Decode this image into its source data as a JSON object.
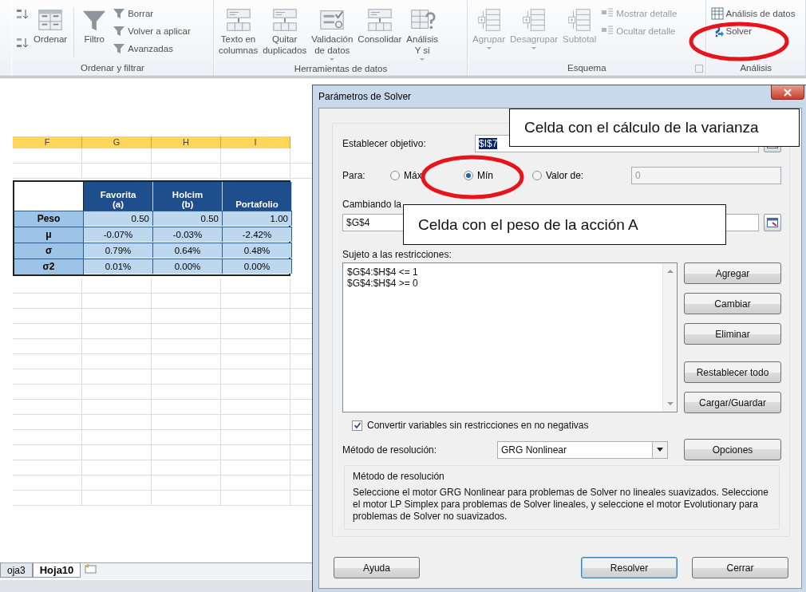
{
  "ribbon": {
    "groups": [
      {
        "label": "Ordenar y filtrar",
        "columns": [
          {
            "kind": "sort-icons"
          },
          {
            "kind": "large",
            "lines": [
              "Ordenar"
            ],
            "disabled": false,
            "dropdown": false
          },
          {
            "kind": "separator"
          },
          {
            "kind": "large",
            "lines": [
              "Filtro"
            ],
            "disabled": false,
            "dropdown": false
          },
          {
            "kind": "stack",
            "items": [
              {
                "label": "Borrar",
                "disabled": false
              },
              {
                "label": "Volver a aplicar",
                "disabled": false
              },
              {
                "label": "Avanzadas",
                "disabled": false
              }
            ]
          }
        ]
      },
      {
        "label": "Herramientas de datos",
        "columns": [
          {
            "kind": "large",
            "lines": [
              "Texto en",
              "columnas"
            ],
            "disabled": false,
            "dropdown": false
          },
          {
            "kind": "large",
            "lines": [
              "Quitar",
              "duplicados"
            ],
            "disabled": false,
            "dropdown": false
          },
          {
            "kind": "large",
            "lines": [
              "Validación",
              "de datos"
            ],
            "disabled": false,
            "dropdown": true
          },
          {
            "kind": "large",
            "lines": [
              "Consolidar"
            ],
            "disabled": false,
            "dropdown": false
          },
          {
            "kind": "large",
            "lines": [
              "Análisis",
              "Y si"
            ],
            "disabled": false,
            "dropdown": true
          }
        ]
      },
      {
        "label": "Esquema",
        "launcher": true,
        "columns": [
          {
            "kind": "large",
            "lines": [
              "Agrupar"
            ],
            "disabled": true,
            "dropdown": true
          },
          {
            "kind": "large",
            "lines": [
              "Desagrupar"
            ],
            "disabled": true,
            "dropdown": true
          },
          {
            "kind": "large",
            "lines": [
              "Subtotal"
            ],
            "disabled": true,
            "dropdown": false
          },
          {
            "kind": "stack",
            "items": [
              {
                "label": "Mostrar detalle",
                "disabled": true
              },
              {
                "label": "Ocultar detalle",
                "disabled": true
              }
            ]
          }
        ]
      },
      {
        "label": "Análisis",
        "columns": [
          {
            "kind": "stack",
            "items": [
              {
                "label": "Análisis de datos",
                "disabled": false
              },
              {
                "label": "Solver",
                "disabled": false
              }
            ]
          }
        ]
      }
    ]
  },
  "sheet": {
    "columns": [
      {
        "label": "F",
        "selected": true
      },
      {
        "label": "G",
        "selected": true
      },
      {
        "label": "H",
        "selected": true
      },
      {
        "label": "I",
        "selected": true
      }
    ],
    "table": {
      "headers": [
        {
          "lines": [
            "Favorita",
            "(a)"
          ]
        },
        {
          "lines": [
            "Holcim",
            "(b)"
          ]
        },
        {
          "lines": [
            "Portafolio"
          ]
        }
      ],
      "rows": [
        {
          "label": "Peso",
          "kind": "weight",
          "values": [
            "0.50",
            "0.50",
            "1.00"
          ]
        },
        {
          "label": "μ",
          "kind": "percent",
          "values": [
            "-0.07%",
            "-0.03%",
            "-2.42%"
          ]
        },
        {
          "label": "σ",
          "kind": "percent",
          "values": [
            "0.79%",
            "0.64%",
            "0.48%"
          ]
        },
        {
          "label": "σ2",
          "kind": "percent",
          "values": [
            "0.01%",
            "0.00%",
            "0.00%"
          ]
        }
      ]
    },
    "tabs": [
      {
        "label": "oja3",
        "selected": false
      },
      {
        "label": "Hoja10",
        "selected": true
      }
    ]
  },
  "dialog": {
    "title": "Parámetros de Solver",
    "objective": {
      "label": "Establecer objetivo:",
      "value": "$I$7",
      "value_selected": true
    },
    "para": {
      "label": "Para:",
      "options": [
        {
          "label": "Máx",
          "selected": false
        },
        {
          "label": "Mín",
          "selected": true
        },
        {
          "label": "Valor de:",
          "selected": false
        }
      ],
      "value": "0",
      "value_disabled": true
    },
    "changing": {
      "label": "Cambiando la",
      "value": "$G$4"
    },
    "constraints": {
      "label": "Sujeto a las restricciones:",
      "items": [
        "$G$4:$H$4 <= 1",
        "$G$4:$H$4 >= 0"
      ]
    },
    "side_button_groups": [
      [
        {
          "label": "Agregar"
        },
        {
          "label": "Cambiar"
        },
        {
          "label": "Eliminar"
        }
      ],
      [
        {
          "label": "Restablecer todo"
        },
        {
          "label": "Cargar/Guardar"
        }
      ]
    ],
    "nonnegative": {
      "label": "Convertir variables sin restricciones en no negativas",
      "checked": true
    },
    "method": {
      "label": "Método de resolución:",
      "value": "GRG Nonlinear",
      "button": "Opciones"
    },
    "info": {
      "title": "Método de resolución",
      "text": "Seleccione el motor GRG Nonlinear para problemas de Solver no lineales suavizados. Seleccione el motor LP Simplex para problemas de Solver lineales, y seleccione el motor Evolutionary para problemas de Solver no suavizados."
    },
    "buttons": [
      {
        "label": "Ayuda",
        "default": false
      },
      {
        "label": "Resolver",
        "default": true
      },
      {
        "label": "Cerrar",
        "default": false
      }
    ]
  },
  "callouts": [
    {
      "text": "Celda con el cálculo de la varianza"
    },
    {
      "text": "Celda con el peso de la acción A"
    }
  ]
}
